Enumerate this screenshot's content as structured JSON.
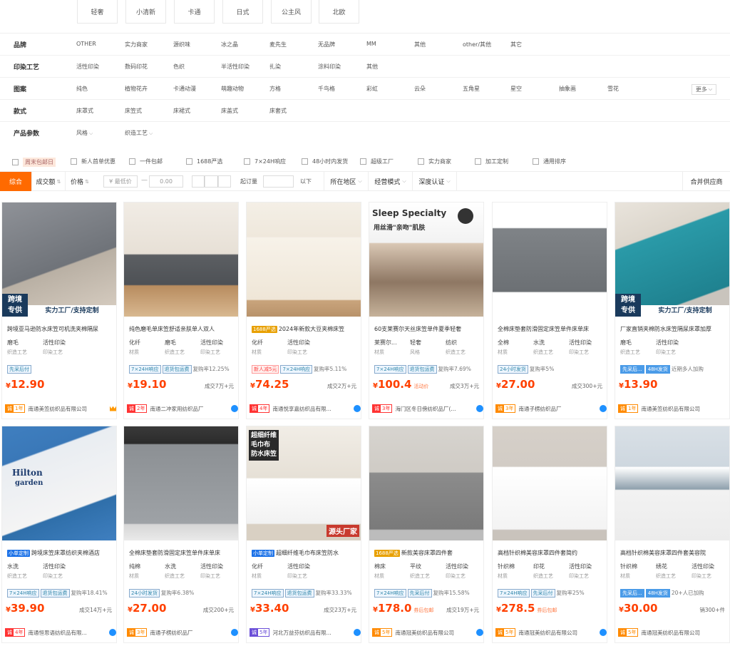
{
  "style_chips": [
    "轻奢",
    "小清新",
    "卡通",
    "日式",
    "公主风",
    "北欧"
  ],
  "filters": {
    "brand": {
      "label": "品牌",
      "items": [
        "OTHER",
        "实力商家",
        "源织味",
        "冰之晶",
        "麦先生",
        "无品牌",
        "MM",
        "其他",
        "other/其他",
        "其它"
      ]
    },
    "print": {
      "label": "印染工艺",
      "items": [
        "活性印染",
        "数码印花",
        "色织",
        "半活性印染",
        "扎染",
        "涂料印染",
        "其他"
      ]
    },
    "pattern": {
      "label": "图案",
      "items": [
        "纯色",
        "植物花卉",
        "卡通动漫",
        "萌趣动物",
        "方格",
        "千鸟格",
        "彩虹",
        "云朵",
        "五角星",
        "星空",
        "抽象画",
        "雪花"
      ],
      "more": "更多"
    },
    "style": {
      "label": "款式",
      "items": [
        "床罩式",
        "床笠式",
        "床裙式",
        "床盖式",
        "床套式"
      ]
    },
    "params": {
      "label": "产品参数",
      "items": [
        "风格",
        "织造工艺"
      ]
    }
  },
  "checks": [
    "周末包邮日",
    "新人首单优惠",
    "一件包邮",
    "1688严选",
    "7×24H响应",
    "48小时内发货",
    "超级工厂",
    "实力商家",
    "加工定制",
    "通用排序"
  ],
  "sortbar": {
    "comprehensive": "综合",
    "deal": "成交额",
    "price": "价格",
    "min_price": "¥ 最低价",
    "dash": "—",
    "max_price": "0.00",
    "moq": "起订量",
    "below": "以下",
    "location": "所在地区",
    "mode": "经营模式",
    "cert": "深度认证",
    "merge": "合并供应商"
  },
  "products": [
    {
      "title": "跨境亚马逊防水床笠可机洗夹棉隔尿",
      "tag": "",
      "attrs": [
        [
          "磨毛",
          "织造工艺"
        ],
        [
          "活性印染",
          "印染工艺"
        ]
      ],
      "badges": [
        [
          "先采后付",
          "b"
        ]
      ],
      "extra": "",
      "price": "12.90",
      "note": "",
      "sales": "",
      "year": "1年",
      "yc": "org",
      "shop": "南通美笠纺织品有限公司",
      "icon": "crown",
      "ov1": "跨境",
      "ov2": "专供",
      "ov3": "实力工厂/支持定制"
    },
    {
      "title": "纯色磨毛单床笠舒适亲肤单人双人",
      "tag": "",
      "attrs": [
        [
          "化纤",
          "材质"
        ],
        [
          "磨毛",
          "织造工艺"
        ],
        [
          "活性印染",
          "印染工艺"
        ]
      ],
      "badges": [
        [
          "7×24H响应",
          "b"
        ],
        [
          "退货包运费",
          "b"
        ]
      ],
      "extra": "复购率12.25%",
      "price": "19.10",
      "note": "",
      "sales": "成交7万+元",
      "year": "2年",
      "yc": "red",
      "shop": "南通二冲家用纺织品厂",
      "icon": "ww"
    },
    {
      "title": "2024年新款大豆夹棉床笠",
      "tag": "1688严选",
      "attrs": [
        [
          "化纤",
          "材质"
        ],
        [
          "活性印染",
          "印染工艺"
        ]
      ],
      "badges": [
        [
          "新人减5元",
          "r"
        ],
        [
          "7×24H响应",
          "b"
        ]
      ],
      "extra": "复购率5.11%",
      "price": "74.25",
      "note": "",
      "sales": "成交2万+元",
      "year": "4年",
      "yc": "red",
      "shop": "南通悦享嘉纺织品有限...",
      "icon": "ww"
    },
    {
      "title": "60支莱赛尔天丝床笠单件夏季轻奢",
      "tag": "",
      "attrs": [
        [
          "莱赛尔...",
          "材质"
        ],
        [
          "轻奢",
          "风格"
        ],
        [
          "纺织",
          "织造工艺"
        ]
      ],
      "badges": [
        [
          "7×24H响应",
          "b"
        ],
        [
          "退货包运费",
          "b"
        ]
      ],
      "extra": "复购率7.69%",
      "price": "100.4",
      "note": "活动价",
      "sales": "成交3万+元",
      "year": "3年",
      "yc": "red",
      "shop": "海门区冬日傍纺织品厂(...",
      "icon": "ww",
      "ov1": "Sleep Specialty",
      "ov2": "用丝滑\"亲吻\"肌肤"
    },
    {
      "title": "全棉床垫套防滑固定床笠单件床单床",
      "tag": "",
      "attrs": [
        [
          "全棉",
          "材质"
        ],
        [
          "水洗",
          "织造工艺"
        ],
        [
          "活性印染",
          "印染工艺"
        ]
      ],
      "badges": [
        [
          "24小时发货",
          "b"
        ]
      ],
      "extra": "复购率5%",
      "price": "27.00",
      "note": "",
      "sales": "成交300+元",
      "year": "3年",
      "yc": "org",
      "shop": "南通子楞纺织品厂",
      "icon": "ww"
    },
    {
      "title": "厂家直销夹棉防水床笠隔尿床罩加厚",
      "tag": "",
      "attrs": [
        [
          "磨毛",
          "织造工艺"
        ],
        [
          "活性印染",
          "印染工艺"
        ]
      ],
      "badges": [
        [
          "先采后...",
          "bb"
        ],
        [
          "48H发货",
          "bb"
        ]
      ],
      "extra": "近期多人加购",
      "price": "13.90",
      "note": "",
      "sales": "",
      "year": "1年",
      "yc": "org",
      "shop": "南通美笠纺织品有限公司",
      "icon": "",
      "ov1": "跨境",
      "ov2": "专供",
      "ov3": "实力工厂/支持定制"
    },
    {
      "title": "跨境床笠床罩纺织夹棉酒店",
      "tag": "小单定制",
      "attrs": [
        [
          "水洗",
          "织造工艺"
        ],
        [
          "活性印染",
          "印染工艺"
        ]
      ],
      "badges": [
        [
          "7×24H响应",
          "b"
        ],
        [
          "退货包运费",
          "b"
        ]
      ],
      "extra": "复购率18.41%",
      "price": "39.90",
      "note": "",
      "sales": "成交14万+元",
      "year": "4年",
      "yc": "red",
      "shop": "南通恒思语纺织品有限...",
      "icon": "ww",
      "ov1": "Hilton",
      "ov2": "garden"
    },
    {
      "title": "全棉床垫套防滑固定床笠单件床单床",
      "tag": "",
      "attrs": [
        [
          "纯棉",
          "材质"
        ],
        [
          "水洗",
          "织造工艺"
        ],
        [
          "活性印染",
          "印染工艺"
        ]
      ],
      "badges": [
        [
          "24小时发货",
          "b"
        ]
      ],
      "extra": "复购率6.38%",
      "price": "27.00",
      "note": "",
      "sales": "成交200+元",
      "year": "3年",
      "yc": "org",
      "shop": "南通子楞纺织品厂",
      "icon": "ww"
    },
    {
      "title": "超细纤维毛巾布床笠防水",
      "tag": "小单定制",
      "attrs": [
        [
          "化纤",
          "材质"
        ],
        [
          "活性印染",
          "印染工艺"
        ]
      ],
      "badges": [
        [
          "7×24H响应",
          "b"
        ],
        [
          "退货包运费",
          "b"
        ]
      ],
      "extra": "复购率33.33%",
      "price": "33.40",
      "note": "",
      "sales": "成交23万+元",
      "year": "5年",
      "yc": "pur",
      "shop": "河北万益芬纺织品有限...",
      "icon": "ww",
      "ov1": "超细纤维",
      "ov2": "毛巾布",
      "ov3": "防水床笠",
      "ov4": "源头厂家"
    },
    {
      "title": "新款美容床罩四件套",
      "tag": "1688严选",
      "attrs": [
        [
          "棉床",
          "材质"
        ],
        [
          "平纹",
          "织造工艺"
        ],
        [
          "活性印染",
          "印染工艺"
        ]
      ],
      "badges": [
        [
          "7×24H响应",
          "b"
        ],
        [
          "先采后付",
          "b"
        ]
      ],
      "extra": "复购率15.58%",
      "price": "178.0",
      "note": "券后包邮",
      "sales": "成交19万+元",
      "year": "5年",
      "yc": "org",
      "shop": "南通冠美纺织品有限公司",
      "icon": "ww"
    },
    {
      "title": "高档针织棉美容床罩四件套简约",
      "tag": "",
      "attrs": [
        [
          "针织棉",
          "材质"
        ],
        [
          "印花",
          "织造工艺"
        ],
        [
          "活性印染",
          "印染工艺"
        ]
      ],
      "badges": [
        [
          "7×24H响应",
          "b"
        ],
        [
          "先采后付",
          "b"
        ]
      ],
      "extra": "复购率25%",
      "price": "278.5",
      "note": "券后包邮",
      "sales": "",
      "year": "5年",
      "yc": "org",
      "shop": "南通冠美纺织品有限公司",
      "icon": "ww"
    },
    {
      "title": "高档针织棉美容床罩四件套美容院",
      "tag": "",
      "attrs": [
        [
          "针织棉",
          "材质"
        ],
        [
          "绣花",
          "织造工艺"
        ],
        [
          "活性印染",
          "印染工艺"
        ]
      ],
      "badges": [
        [
          "先采后...",
          "bb"
        ],
        [
          "48H发货",
          "bb"
        ]
      ],
      "extra": "20+人已加购",
      "price": "30.00",
      "note": "",
      "sales": "销300+件",
      "year": "5年",
      "yc": "org",
      "shop": "南通冠美纺织品有限公司",
      "icon": ""
    }
  ],
  "colors": {
    "accent": "#ff6a00",
    "price": "#ff4000",
    "link": "#1e90ff"
  }
}
